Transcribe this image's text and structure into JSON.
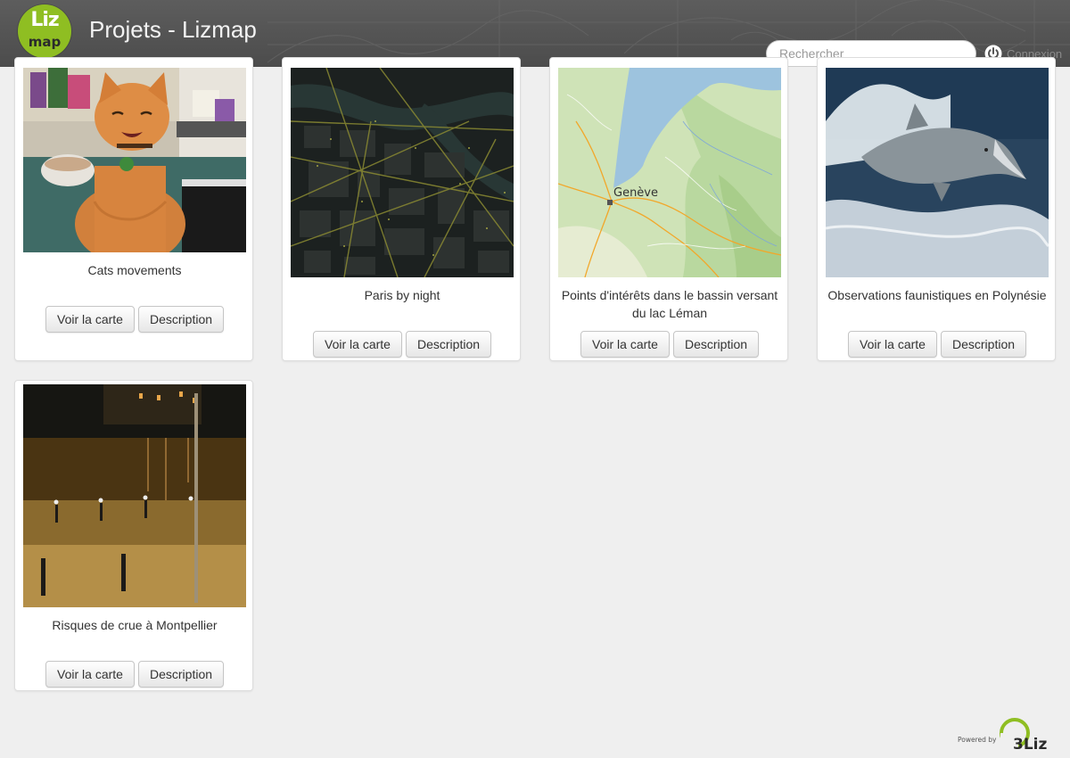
{
  "header": {
    "logo_top": "Liz",
    "logo_bottom": "map",
    "title": "Projets - Lizmap",
    "search_placeholder": "Rechercher",
    "login_label": "Connexion"
  },
  "projects": [
    {
      "title": "Cats movements",
      "thumbnail": "orange-cat-photo",
      "view_label": "Voir la carte",
      "description_label": "Description"
    },
    {
      "title": "Paris by night",
      "thumbnail": "paris-night-map",
      "view_label": "Voir la carte",
      "description_label": "Description"
    },
    {
      "title": "Points d'intérêts dans le bassin versant du lac Léman",
      "thumbnail": "geneva-lake-map",
      "map_label": "Genève",
      "view_label": "Voir la carte",
      "description_label": "Description"
    },
    {
      "title": "Observations faunistiques en Polynésie",
      "thumbnail": "dolphin-photo",
      "view_label": "Voir la carte",
      "description_label": "Description"
    },
    {
      "title": "Risques de crue à Montpellier",
      "thumbnail": "flooded-street-night-photo",
      "view_label": "Voir la carte",
      "description_label": "Description"
    }
  ],
  "footer": {
    "powered_by": "Powered by",
    "brand": "3Liz"
  },
  "colors": {
    "header_bg": "#4c4c4c",
    "page_bg": "#efefef",
    "logo_green": "#8fbe22"
  }
}
